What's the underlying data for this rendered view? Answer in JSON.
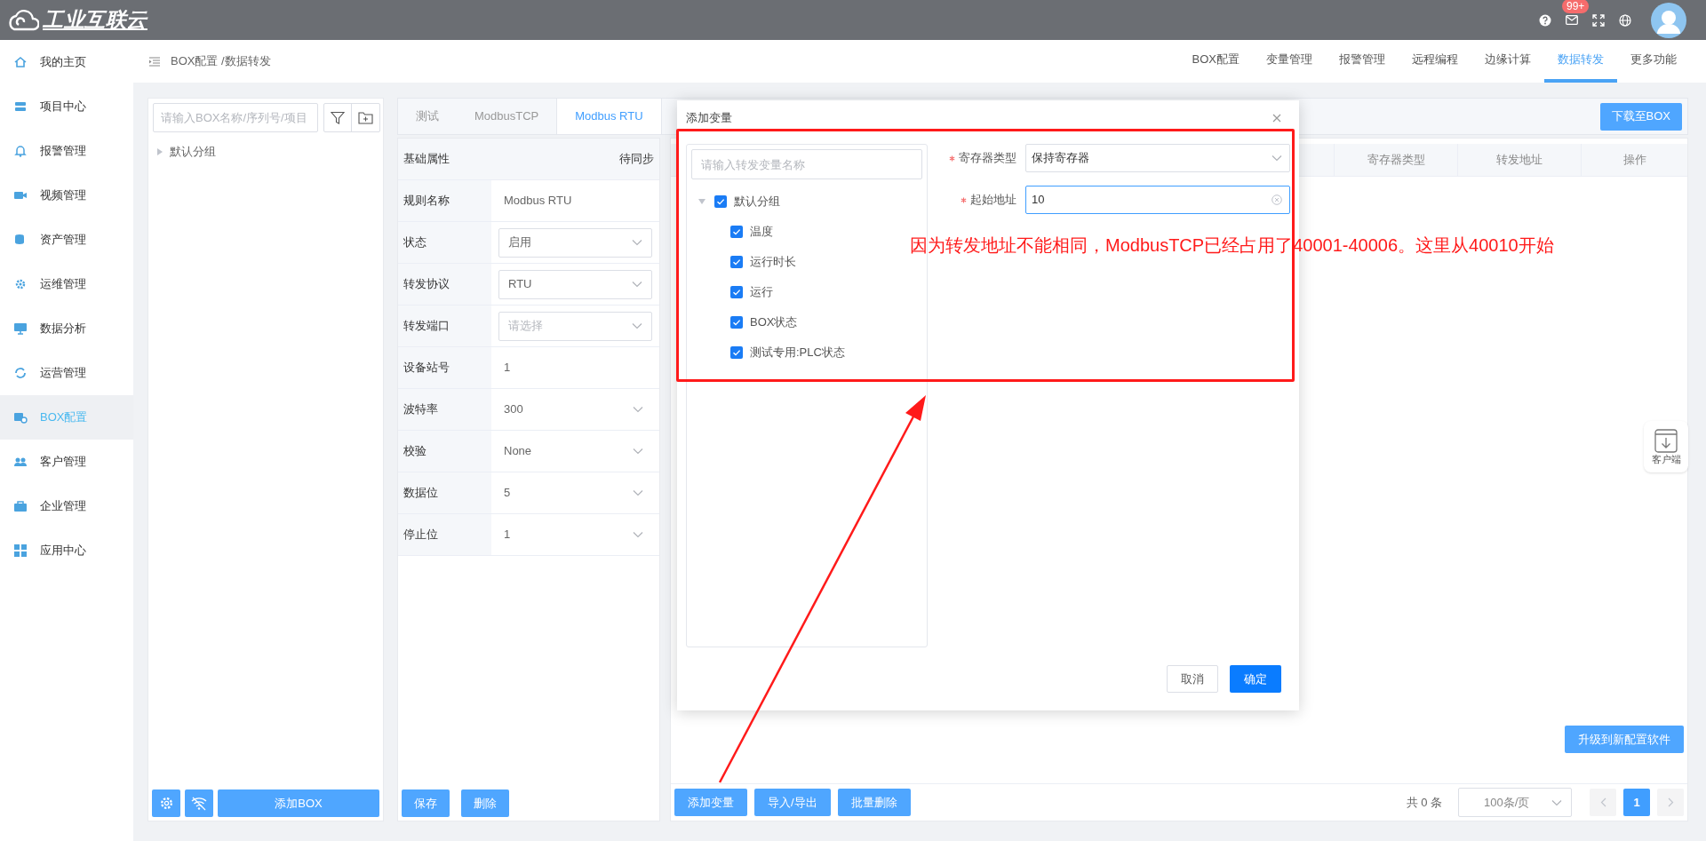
{
  "topbar": {
    "logo": "工业互联云",
    "mail_badge": "99+"
  },
  "sidebar": {
    "items": [
      {
        "label": "我的主页",
        "selected": false
      },
      {
        "label": "项目中心",
        "selected": false
      },
      {
        "label": "报警管理",
        "selected": false
      },
      {
        "label": "视频管理",
        "selected": false
      },
      {
        "label": "资产管理",
        "selected": false
      },
      {
        "label": "运维管理",
        "selected": false
      },
      {
        "label": "数据分析",
        "selected": false
      },
      {
        "label": "运营管理",
        "selected": false
      },
      {
        "label": "BOX配置",
        "selected": true
      },
      {
        "label": "客户管理",
        "selected": false
      },
      {
        "label": "企业管理",
        "selected": false
      },
      {
        "label": "应用中心",
        "selected": false
      }
    ]
  },
  "breadcrumb": "BOX配置 /数据转发",
  "nav_tabs": [
    {
      "label": "BOX配置",
      "selected": false
    },
    {
      "label": "变量管理",
      "selected": false
    },
    {
      "label": "报警管理",
      "selected": false
    },
    {
      "label": "远程编程",
      "selected": false
    },
    {
      "label": "边缘计算",
      "selected": false
    },
    {
      "label": "数据转发",
      "selected": true
    },
    {
      "label": "更多功能",
      "selected": false
    }
  ],
  "box_panel": {
    "search": {
      "placeholder": "请输入BOX名称/序列号/项目"
    },
    "tree": [
      {
        "label": "默认分组",
        "expanded": false
      }
    ],
    "add_button": "添加BOX"
  },
  "rule_tabs": [
    {
      "label": "测试",
      "selected": false
    },
    {
      "label": "ModbusTCP",
      "selected": false
    },
    {
      "label": "Modbus RTU",
      "selected": true
    }
  ],
  "download_button": "下载至BOX",
  "properties": {
    "header": "基础属性",
    "sync_status": "待同步",
    "rows": [
      {
        "label": "规则名称",
        "kind": "text",
        "value": "Modbus RTU"
      },
      {
        "label": "状态",
        "kind": "select",
        "value": "启用"
      },
      {
        "label": "转发协议",
        "kind": "select",
        "value": "RTU"
      },
      {
        "label": "转发端口",
        "kind": "select",
        "placeholder": "请选择"
      },
      {
        "label": "设备站号",
        "kind": "text",
        "value": "1"
      },
      {
        "label": "波特率",
        "kind": "dropdown",
        "value": "300"
      },
      {
        "label": "校验",
        "kind": "dropdown",
        "value": "None"
      },
      {
        "label": "数据位",
        "kind": "dropdown",
        "value": "5"
      },
      {
        "label": "停止位",
        "kind": "dropdown",
        "value": "1"
      }
    ],
    "buttons": [
      "保存",
      "删除"
    ]
  },
  "table": {
    "columns": [
      "寄存器类型",
      "转发地址",
      "操作"
    ]
  },
  "upgrade_button": "升级到新配置软件",
  "footer_buttons": [
    "添加变量",
    "导入/导出",
    "批量删除"
  ],
  "pagination": {
    "total": "共 0 条",
    "page_size": "100条/页",
    "pages": [
      {
        "label": "1",
        "selected": true
      }
    ]
  },
  "client_widget": "客户端",
  "dialog": {
    "title": "添加变量",
    "search": {
      "placeholder": "请输入转发变量名称"
    },
    "tree": [
      {
        "label": "默认分组",
        "checked": true,
        "expanded": true,
        "children": [
          {
            "label": "温度",
            "checked": true
          },
          {
            "label": "运行时长",
            "checked": true
          },
          {
            "label": "运行",
            "checked": true
          },
          {
            "label": "BOX状态",
            "checked": true
          },
          {
            "label": "测试专用:PLC状态",
            "checked": true
          }
        ]
      }
    ],
    "fields": [
      {
        "label": "寄存器类型",
        "required": true,
        "kind": "select",
        "value": "保持寄存器",
        "focused": false
      },
      {
        "label": "起始地址",
        "required": true,
        "kind": "input",
        "value": "10",
        "focused": true
      }
    ],
    "buttons": [
      {
        "label": "取消",
        "kind": "default"
      },
      {
        "label": "确定",
        "kind": "primary"
      }
    ]
  },
  "annotation": {
    "text": "因为转发地址不能相同，ModbusTCP已经占用了40001-40006。这里从40010开始"
  }
}
